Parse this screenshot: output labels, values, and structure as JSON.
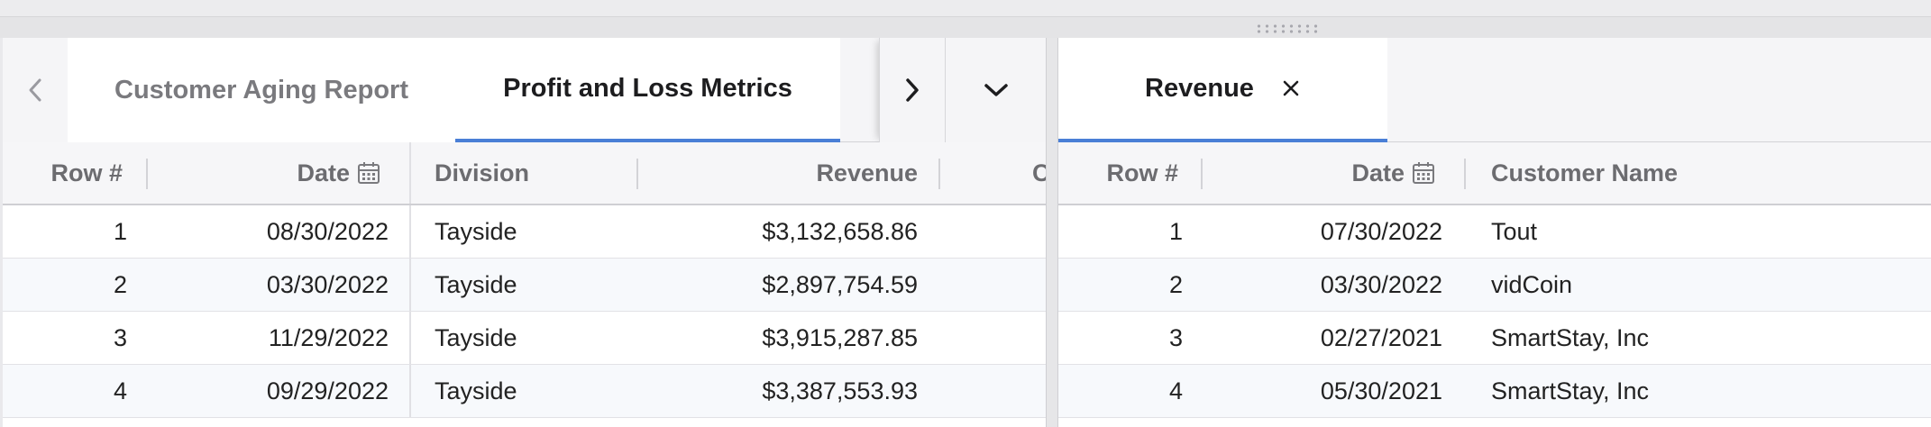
{
  "left_panel": {
    "tabs": [
      {
        "label": "Customer Aging Report",
        "active": false
      },
      {
        "label": "Profit and Loss Metrics",
        "active": true
      }
    ],
    "columns": [
      "Row #",
      "Date",
      "Division",
      "Revenue",
      "C"
    ],
    "rows": [
      {
        "row": "1",
        "date": "08/30/2022",
        "division": "Tayside",
        "revenue": "$3,132,658.86"
      },
      {
        "row": "2",
        "date": "03/30/2022",
        "division": "Tayside",
        "revenue": "$2,897,754.59"
      },
      {
        "row": "3",
        "date": "11/29/2022",
        "division": "Tayside",
        "revenue": "$3,915,287.85"
      },
      {
        "row": "4",
        "date": "09/29/2022",
        "division": "Tayside",
        "revenue": "$3,387,553.93"
      }
    ]
  },
  "right_panel": {
    "tabs": [
      {
        "label": "Revenue",
        "active": true,
        "closable": true
      }
    ],
    "columns": [
      "Row #",
      "Date",
      "Customer Name"
    ],
    "rows": [
      {
        "row": "1",
        "date": "07/30/2022",
        "customer": "Tout"
      },
      {
        "row": "2",
        "date": "03/30/2022",
        "customer": "vidCoin"
      },
      {
        "row": "3",
        "date": "02/27/2021",
        "customer": "SmartStay, Inc"
      },
      {
        "row": "4",
        "date": "05/30/2021",
        "customer": "SmartStay, Inc"
      }
    ]
  },
  "icons": {
    "prev": "chevron-left-icon",
    "next": "chevron-right-icon",
    "menu": "chevron-down-icon",
    "close": "close-icon",
    "calendar": "calendar-icon",
    "resize": "drag-handle-icon"
  },
  "colors": {
    "active_tab_underline": "#4a7fd6",
    "alt_row": "#f7f9fc"
  }
}
